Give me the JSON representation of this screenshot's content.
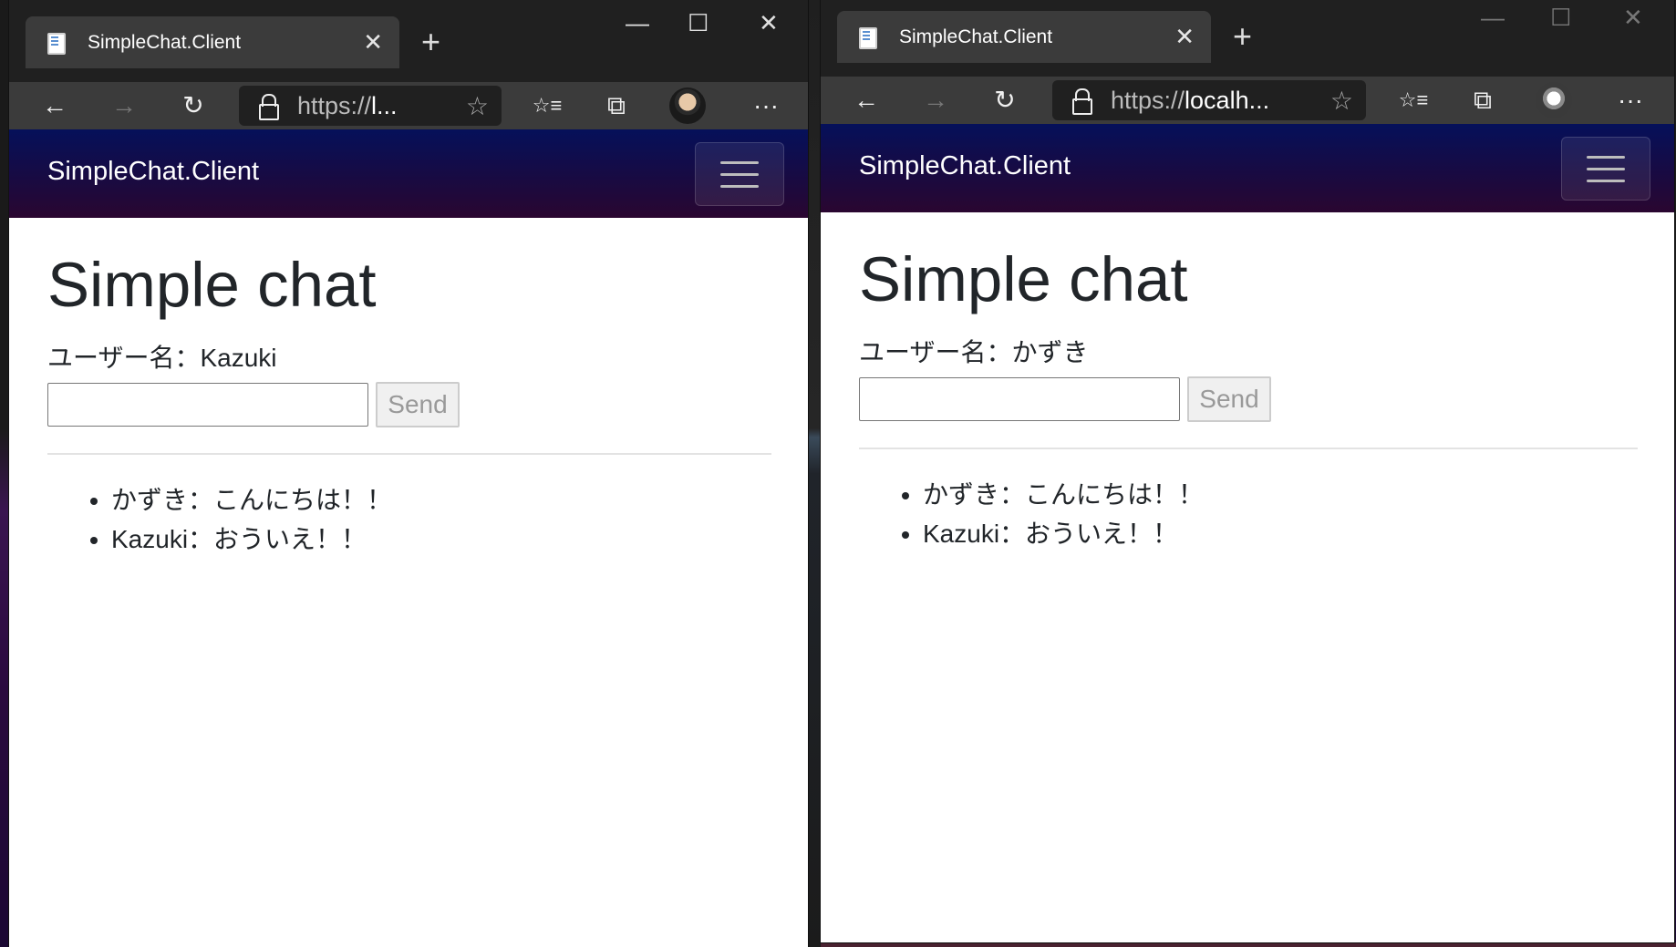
{
  "windows": {
    "left": {
      "tab_title": "SimpleChat.Client",
      "tab_close": "✕",
      "new_tab": "+",
      "url_prefix": "https://",
      "url_rest": "l...",
      "brand": "SimpleChat.Client",
      "heading": "Simple chat",
      "username_label": "ユーザー名：Kazuki",
      "send_label": "Send",
      "messages": [
        "かずき：こんにちは！！",
        "Kazuki：おういえ！！"
      ],
      "window_controls": {
        "minimize": "—",
        "maximize": "☐",
        "close": "✕"
      }
    },
    "right": {
      "tab_title": "SimpleChat.Client",
      "tab_close": "✕",
      "new_tab": "+",
      "url_prefix": "https://",
      "url_rest": "localh...",
      "brand": "SimpleChat.Client",
      "heading": "Simple chat",
      "username_label": "ユーザー名：かずき",
      "send_label": "Send",
      "messages": [
        "かずき：こんにちは！！",
        "Kazuki：おういえ！！"
      ],
      "window_controls": {
        "minimize": "—",
        "maximize": "☐",
        "close": "✕"
      }
    }
  },
  "toolbar_icons": {
    "back": "←",
    "forward": "→",
    "refresh": "↻",
    "favorite": "☆",
    "favorites": "☆≡",
    "collections": "⧉",
    "more": "···"
  },
  "colors": {
    "navbar_top": "#05105a",
    "navbar_bottom": "#2a0630",
    "chrome_dark": "#202020",
    "chrome_toolbar": "#3b3b3b"
  }
}
